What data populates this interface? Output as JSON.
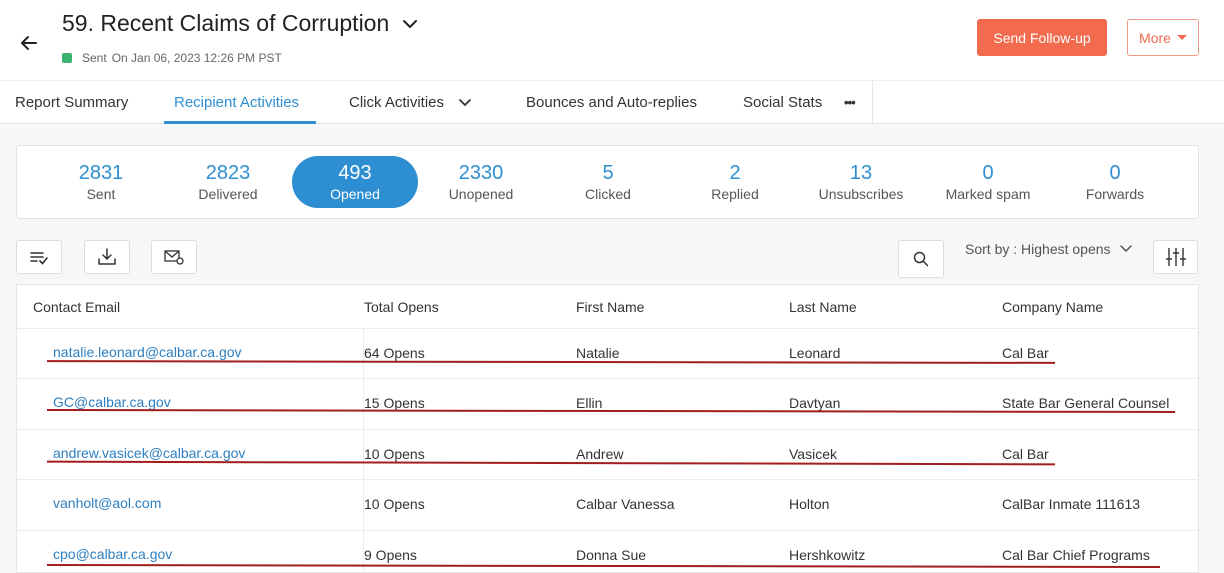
{
  "header": {
    "title": "59. Recent Claims of Corruption",
    "status": "Sent",
    "sent_on": "On Jan 06, 2023 12:26 PM PST",
    "followup_label": "Send Follow-up",
    "more_label": "More"
  },
  "tabs": [
    {
      "label": "Report Summary"
    },
    {
      "label": "Recipient Activities"
    },
    {
      "label": "Click Activities"
    },
    {
      "label": "Bounces and Auto-replies"
    },
    {
      "label": "Social Stats"
    },
    {
      "label": "•••"
    }
  ],
  "stats": [
    {
      "value": "2831",
      "label": "Sent"
    },
    {
      "value": "2823",
      "label": "Delivered"
    },
    {
      "value": "493",
      "label": "Opened"
    },
    {
      "value": "2330",
      "label": "Unopened"
    },
    {
      "value": "5",
      "label": "Clicked"
    },
    {
      "value": "2",
      "label": "Replied"
    },
    {
      "value": "13",
      "label": "Unsubscribes"
    },
    {
      "value": "0",
      "label": "Marked spam"
    },
    {
      "value": "0",
      "label": "Forwards"
    }
  ],
  "toolbar": {
    "sort_label": "Sort by : Highest opens"
  },
  "table": {
    "headers": [
      "Contact Email",
      "Total Opens",
      "First Name",
      "Last Name",
      "Company Name"
    ],
    "rows": [
      {
        "email": "natalie.leonard@calbar.ca.gov",
        "opens": "64 Opens",
        "first": "Natalie",
        "last": "Leonard",
        "company": "Cal Bar"
      },
      {
        "email": "GC@calbar.ca.gov",
        "opens": "15 Opens",
        "first": "Ellin",
        "last": "Davtyan",
        "company": "State Bar General Counsel"
      },
      {
        "email": "andrew.vasicek@calbar.ca.gov",
        "opens": "10 Opens",
        "first": "Andrew",
        "last": "Vasicek",
        "company": "Cal Bar"
      },
      {
        "email": "vanholt@aol.com",
        "opens": "10 Opens",
        "first": "Calbar Vanessa",
        "last": "Holton",
        "company": "CalBar Inmate 111613"
      },
      {
        "email": "cpo@calbar.ca.gov",
        "opens": "9 Opens",
        "first": "Donna Sue",
        "last": "Hershkowitz",
        "company": "Cal Bar Chief Programs"
      }
    ]
  },
  "colors": {
    "accent": "#2d8fd1",
    "followup": "#f26b4f",
    "annotation": "#a31d1d"
  }
}
